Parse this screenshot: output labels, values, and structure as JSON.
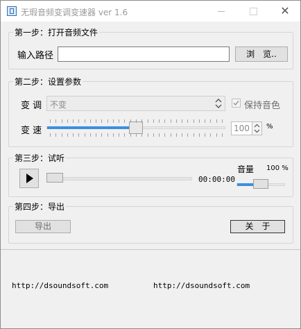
{
  "window": {
    "title": "无瑕音频变调变速器 ver 1.6",
    "close_glyph": "✕"
  },
  "step1": {
    "legend": "第一步：打开音频文件",
    "path_label": "输入路径",
    "path_value": "",
    "browse_label": "浏　览.."
  },
  "step2": {
    "legend": "第二步：设置参数",
    "pitch_label": "变 调",
    "pitch_value": "不变",
    "keep_tone_label": "保持音色",
    "keep_tone_checked": true,
    "speed_label": "变 速",
    "speed_value": "100",
    "speed_unit": "%",
    "speed_slider_level": 0.5
  },
  "step3": {
    "legend": "第三步：试听",
    "time": "00:00:00",
    "volume_label": "音量",
    "volume_value": "100 %",
    "playback_level": 0,
    "volume_level": 0.5
  },
  "step4": {
    "legend": "第四步：导出",
    "export_label": "导出",
    "about_label": "关　于"
  },
  "footer": {
    "link1": "http://dsoundsoft.com",
    "link2": "http://dsoundsoft.com"
  }
}
